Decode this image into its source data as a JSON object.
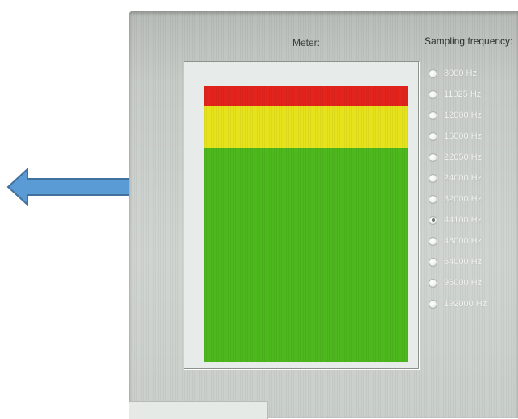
{
  "meter": {
    "heading": "Meter:",
    "segments": [
      {
        "name": "red",
        "color": "#e3241d"
      },
      {
        "name": "yellow",
        "color": "#e6e31d"
      },
      {
        "name": "green",
        "color": "#4cb81d"
      }
    ]
  },
  "sampling": {
    "heading": "Sampling frequency:",
    "options": [
      {
        "label": "8000 Hz",
        "selected": false
      },
      {
        "label": "11025 Hz",
        "selected": false
      },
      {
        "label": "12000 Hz",
        "selected": false
      },
      {
        "label": "16000 Hz",
        "selected": false
      },
      {
        "label": "22050 Hz",
        "selected": false
      },
      {
        "label": "24000 Hz",
        "selected": false
      },
      {
        "label": "32000 Hz",
        "selected": false
      },
      {
        "label": "44100 Hz",
        "selected": true
      },
      {
        "label": "48000 Hz",
        "selected": false
      },
      {
        "label": "64000 Hz",
        "selected": false
      },
      {
        "label": "96000 Hz",
        "selected": false
      },
      {
        "label": "192000 Hz",
        "selected": false
      }
    ]
  },
  "callout": {
    "icon": "left-arrow-icon",
    "fill": "#5b9bd5",
    "stroke": "#41719c"
  }
}
